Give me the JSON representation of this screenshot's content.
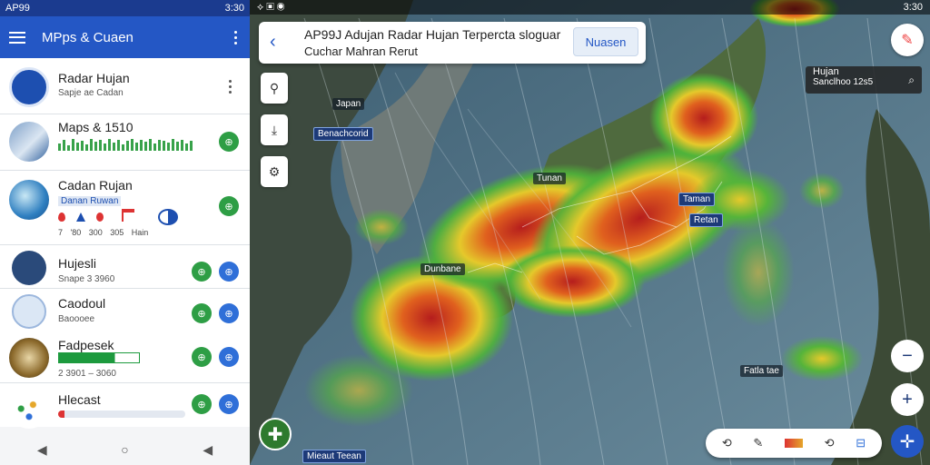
{
  "phone_status": {
    "left_text": "AP99",
    "right_text": "3:30"
  },
  "app": {
    "title": "MPps & Cuaen"
  },
  "items": [
    {
      "name": "Radar Hujan",
      "sub": "Sapje ae Cadan"
    },
    {
      "name": "Maps & 1510",
      "sub": ""
    },
    {
      "name": "Cadan Rujan",
      "sub": "Danan Ruwan",
      "stats": "7 '80  300  305  Hain"
    },
    {
      "name": "Hujesli",
      "sub": "Snape 3 3960"
    },
    {
      "name": "Caodoul",
      "sub": "Baoooee"
    },
    {
      "name": "Fadpesek",
      "sub": "2 3901 – 3060"
    },
    {
      "name": "Hlecast",
      "sub": ""
    }
  ],
  "map_status": {
    "right_text": "3:30"
  },
  "top_card": {
    "line1": "AP99J Adujan Radar Hujan Terpercta sloguar",
    "line2": "Cuchar Mahran Rerut",
    "button": "Nuasen"
  },
  "search_box": {
    "line1": "Hujan",
    "line2": "Sanclhoo 12s5"
  },
  "map_labels": [
    "Japan",
    "Benachcorid",
    "Tunan",
    "Taman",
    "Retan",
    "Dunbane",
    "Fatla tae",
    "Mieaut Teean"
  ],
  "icons": {
    "map_zoom_out": "minus-icon",
    "map_zoom_in": "plus-icon",
    "locate": "compass-icon"
  }
}
